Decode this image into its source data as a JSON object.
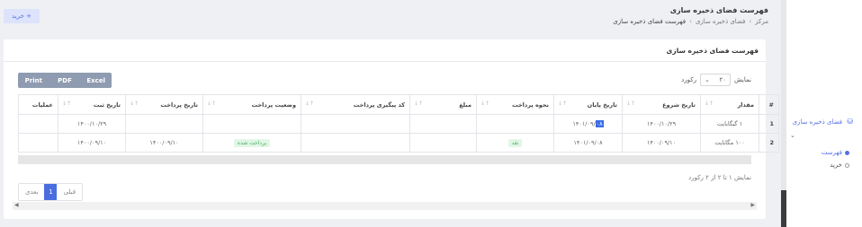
{
  "header": {
    "buy_button": "+ خرید",
    "title": "فهرست فضای ذخیره سازی",
    "breadcrumb": [
      "مرکز",
      "فضای ذخیره سازی",
      "فهرست فضای ذخیره سازی"
    ]
  },
  "card": {
    "title": "فهرست فضای ذخیره سازی",
    "export_buttons": [
      "Print",
      "PDF",
      "Excel"
    ],
    "length": {
      "label_before": "نمایش",
      "value": "۲۰",
      "label_after": "رکورد"
    },
    "columns": [
      "#",
      "مقدار",
      "تاریخ شروع",
      "تاریخ پایان",
      "نحوه پرداخت",
      "مبلغ",
      "کد پیگیری پرداخت",
      "وضعیت پرداخت",
      "تاریخ پرداخت",
      "تاریخ ثبت",
      "عملیات"
    ],
    "rows": [
      {
        "num": "1",
        "amount": "۱ گیگابایت",
        "start": "۱۴۰۰/۱۰/۲۹",
        "end_hl": "۰۸",
        "end_rest": "۱۴۰۱/۰۹/",
        "method": "",
        "price": "",
        "tracking": "",
        "status": "",
        "paid": "",
        "registered": "۱۴۰۰/۱۰/۲۹",
        "ops": ""
      },
      {
        "num": "2",
        "amount": "۱۰۰ مگابایت",
        "start": "۱۴۰۰/۰۹/۱۰",
        "end_hl": "",
        "end_rest": "۱۴۰۱/۰۹/۰۸",
        "method": "نقد",
        "price": "",
        "tracking": "",
        "status": "پرداخت شده",
        "paid": "۱۴۰۰/۰۹/۱۰",
        "registered": "۱۴۰۰/۰۹/۱۰",
        "ops": ""
      }
    ],
    "info": "نمایش ۱ تا ۲ از ۲ رکورد",
    "pager": {
      "prev": "قبلی",
      "page": "1",
      "next": "بعدی"
    }
  },
  "sidebar": {
    "menu_label": "فضای ذخیره سازی",
    "items": [
      {
        "label": "فهرست",
        "active": true
      },
      {
        "label": "خرید",
        "active": false
      }
    ]
  },
  "colors": {
    "accent": "#4a6ee0",
    "success": "#4caf64"
  }
}
